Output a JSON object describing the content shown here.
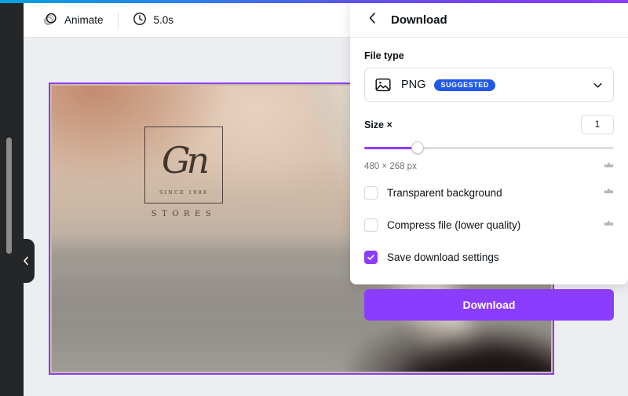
{
  "toolbar": {
    "animate_label": "Animate",
    "duration_label": "5.0s",
    "animate_icon": "animate-circles-icon",
    "clock_icon": "clock-icon"
  },
  "sidebar": {
    "collapse_icon": "chevron-left-icon"
  },
  "canvas": {
    "logo": {
      "monogram": "Gn",
      "since": "SINCE 1988",
      "brand": "STORES"
    }
  },
  "panel": {
    "back_icon": "chevron-left-icon",
    "title": "Download",
    "file_type": {
      "label": "File type",
      "icon": "image-icon",
      "value": "PNG",
      "badge": "SUGGESTED",
      "chevron_icon": "chevron-down-icon"
    },
    "size": {
      "label": "Size ×",
      "value": "1",
      "slider_percent": 21.5,
      "dimensions": "480 × 268 px",
      "crown_icon": "crown-icon"
    },
    "options": [
      {
        "label": "Transparent background",
        "checked": false,
        "pro": true,
        "crown_icon": "crown-icon"
      },
      {
        "label": "Compress file (lower quality)",
        "checked": false,
        "pro": true,
        "crown_icon": "crown-icon"
      },
      {
        "label": "Save download settings",
        "checked": true,
        "pro": false,
        "crown_icon": ""
      }
    ],
    "download_button": "Download"
  },
  "colors": {
    "accent_purple": "#8b3dff",
    "badge_blue": "#2158e8",
    "rail_dark": "#252627",
    "canvas_bg": "#edeef2"
  }
}
